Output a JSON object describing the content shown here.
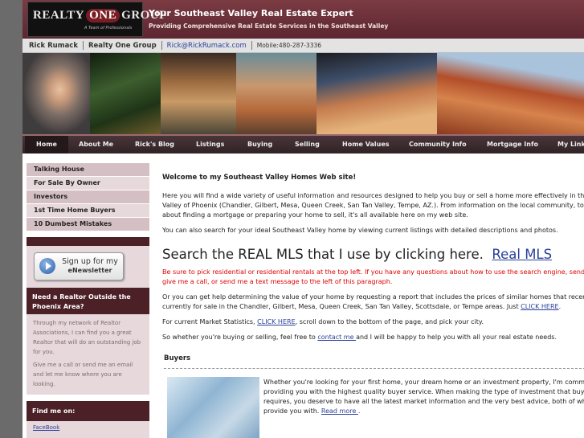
{
  "header": {
    "logo_left": "REALTY",
    "logo_mid": "ONE",
    "logo_right": "GROUP",
    "logo_tagline": "A Team of Professionals",
    "title": "Your Southeast Valley Real Estate Expert",
    "subtitle": "Providing Comprehensive Real Estate Services in the Southeast Valley"
  },
  "contact_bar": {
    "name": "Rick Rumack",
    "company": "Realty One Group",
    "email": "Rick@RickRumack.com",
    "phone": "Mobile:480-287-3336"
  },
  "nav": {
    "items": [
      "Home",
      "About Me",
      "Rick's Blog",
      "Listings",
      "Buying",
      "Selling",
      "Home Values",
      "Community Info",
      "Mortgage Info",
      "My Links"
    ],
    "active": "Home"
  },
  "sidebar": {
    "links": [
      "Talking House",
      "For Sale By Owner",
      "Investors",
      "1st Time Home Buyers",
      "10 Dumbest Mistakes"
    ],
    "signup_line1": "Sign up for my",
    "signup_line2": "eNewsletter",
    "realtor_box": {
      "title": "Need a Realtor Outside the Phoenix Area?",
      "para1": "Through my network of Realtor Associations, I can find you a great Realtor that will do an outstanding job for you.",
      "para2": "Give me a call or send me an email and let me know where you are looking."
    },
    "find_me_title": "Find me on:",
    "find_me_link": "FaceBook"
  },
  "main": {
    "welcome": "Welcome to my Southeast Valley Homes Web site!",
    "intro_line1": "Here you will find a wide variety of useful information and resources designed to help you buy or sell a home more effectively in the Southeast",
    "intro_line2": "Valley of Phoenix (Chandler, Gilbert, Mesa, Queen Creek, San Tan Valley, Tempe, AZ.). From information on the local community, to advice",
    "intro_line3": "about finding a mortgage or preparing your home to sell, it's all available here on my web site.",
    "search_line": "You can also search for your ideal Southeast Valley home by viewing current listings with detailed descriptions and photos.",
    "mls_heading": "Search the REAL MLS that I use by clicking here.",
    "mls_link": "Real MLS",
    "red_line1": "Be sure to pick residential or residential rentals at the top left. If you have any questions about how to use the search engine, send me an email,",
    "red_line2": "give me a call,  or send me a text message to the left of this paragraph.",
    "value_line1": "Or you can get help determining the value of your home by requesting a report that includes the prices of similar homes that recently sold or are",
    "value_line2_pre": "currently for sale in the Chandler, Gilbert, Mesa, Queen Creek, San Tan Valley, Scottsdale, or Tempe areas. Just ",
    "value_link": "CLICK HERE",
    "value_line2_post": ".",
    "stats_pre": "For current Market Statistics, ",
    "stats_link": "CLICK HERE",
    "stats_post": ", scroll down to the bottom of the page, and pick your city.",
    "contact_pre": "So whether you're buying or selling, feel free to ",
    "contact_link": "contact me ",
    "contact_post": "and I will be happy to help you with all your real estate needs.",
    "buyers_title": "Buyers",
    "buyers_line1": "Whether you're looking for your first home, your dream home or an investment property, I'm committed to",
    "buyers_line2": "providing you with the highest quality buyer service. When making the type of investment that buying a home",
    "buyers_line3": "requires, you deserve to have all the latest market information and the very best advice, both of which I can",
    "buyers_line4_pre": "provide you with. ",
    "buyers_link": "Read more ",
    "buyers_line4_post": "."
  }
}
